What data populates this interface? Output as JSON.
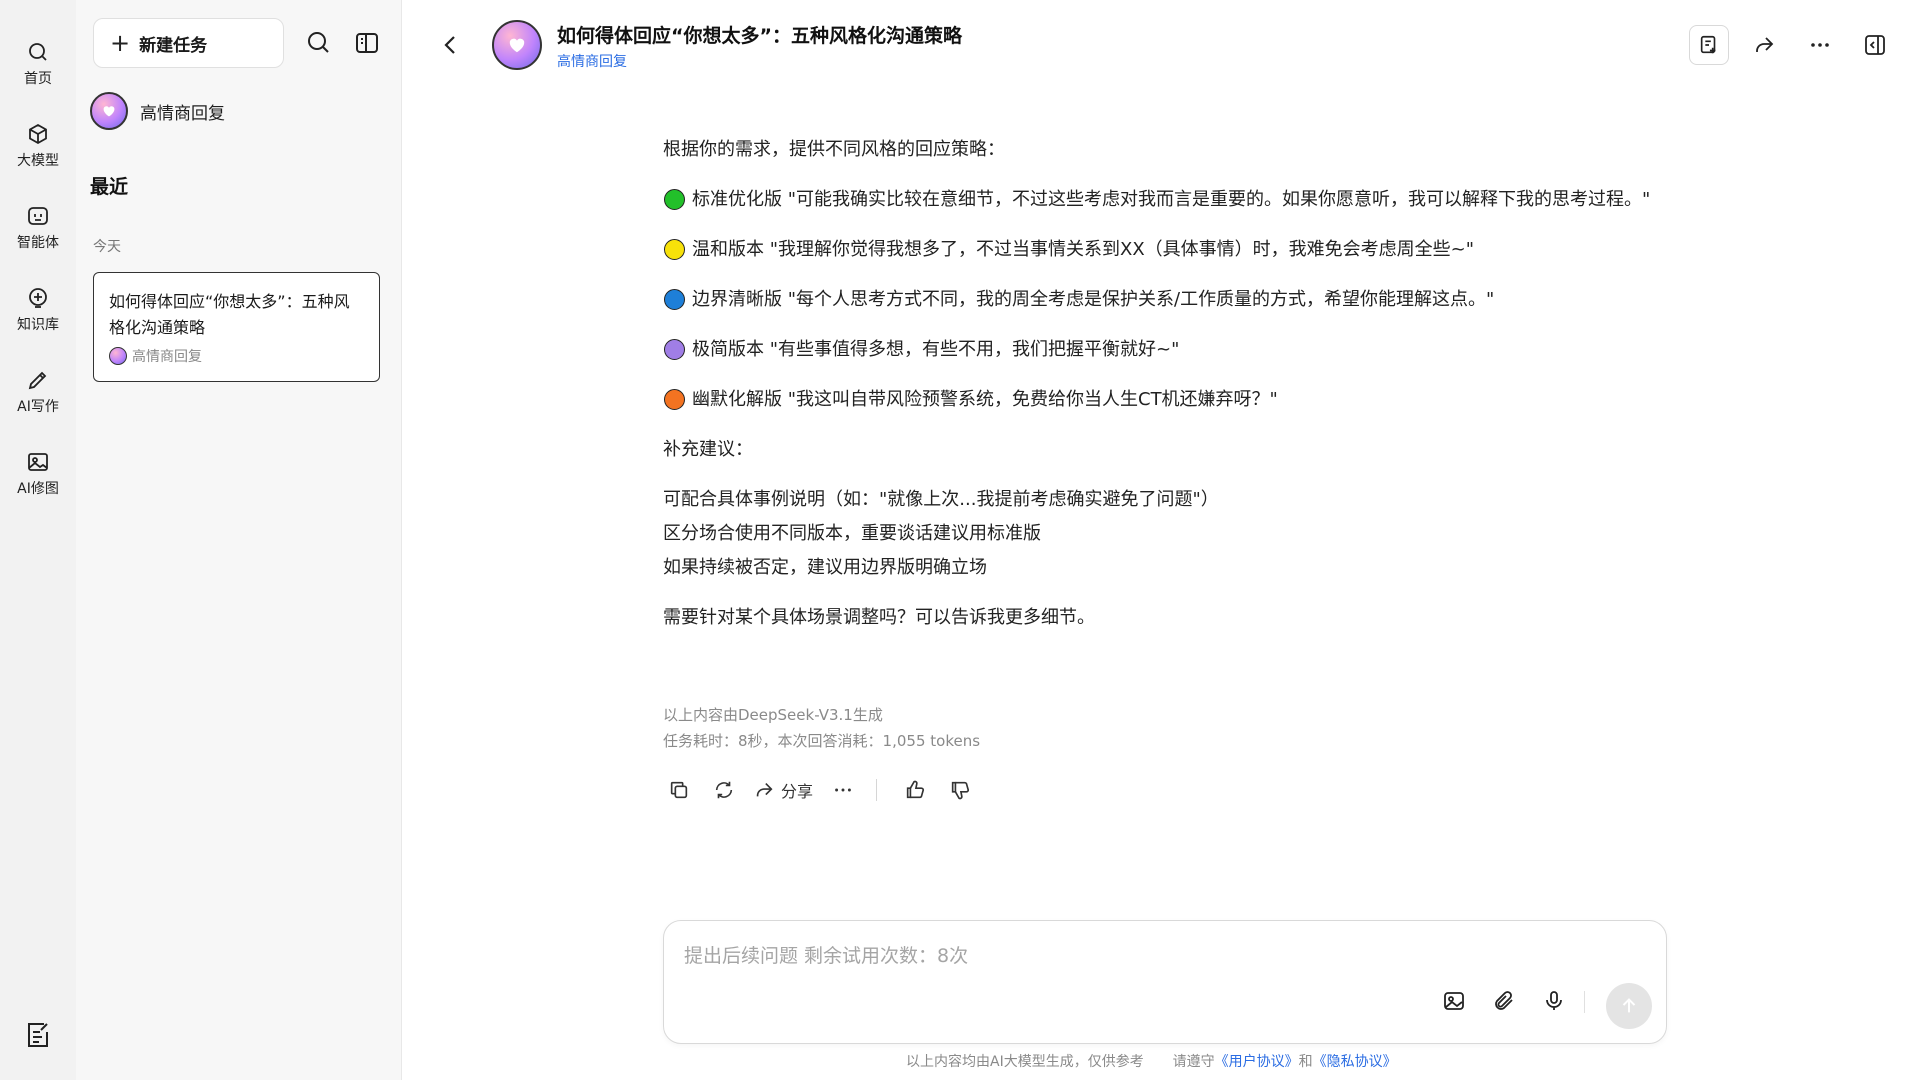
{
  "rail": {
    "items": [
      {
        "label": "首页",
        "icon": "search-icon"
      },
      {
        "label": "大模型",
        "icon": "cube-icon"
      },
      {
        "label": "智能体",
        "icon": "bot-icon"
      },
      {
        "label": "知识库",
        "icon": "knowledge-icon"
      },
      {
        "label": "AI写作",
        "icon": "pencil-icon"
      },
      {
        "label": "AI修图",
        "icon": "image-icon"
      }
    ]
  },
  "sidebar": {
    "new_task": "新建任务",
    "agent_name": "高情商回复",
    "recent_label": "最近",
    "today_label": "今天",
    "task": {
      "title": "如何得体回应“你想太多”：五种风格化沟通策略",
      "agent": "高情商回复"
    }
  },
  "header": {
    "title": "如何得体回应“你想太多”：五种风格化沟通策略",
    "subtitle": "高情商回复"
  },
  "message": {
    "intro": "根据你的需求，提供不同风格的回应策略：",
    "items": [
      {
        "color": "#22c02a",
        "text": "标准优化版 \"可能我确实比较在意细节，不过这些考虑对我而言是重要的。如果你愿意听，我可以解释下我的思考过程。\""
      },
      {
        "color": "#f7e10a",
        "text": "温和版本 \"我理解你觉得我想多了，不过当事情关系到XX（具体事情）时，我难免会考虑周全些~\""
      },
      {
        "color": "#1e7fd8",
        "text": "边界清晰版 \"每个人思考方式不同，我的周全考虑是保护关系/工作质量的方式，希望你能理解这点。\""
      },
      {
        "color": "#a07ee6",
        "text": "极简版本 \"有些事值得多想，有些不用，我们把握平衡就好~\""
      },
      {
        "color": "#f37321",
        "text": "幽默化解版 \"我这叫自带风险预警系统，免费给你当人生CT机还嫌弃呀？\""
      }
    ],
    "supplement_title": "补充建议：",
    "supplements": [
      "可配合具体事例说明（如：\"就像上次...我提前考虑确实避免了问题\"）",
      "区分场合使用不同版本，重要谈话建议用标准版",
      "如果持续被否定，建议用边界版明确立场"
    ],
    "closing": "需要针对某个具体场景调整吗？可以告诉我更多细节。",
    "meta_model": "以上内容由DeepSeek-V3.1生成",
    "meta_usage": "任务耗时：8秒，本次回答消耗：1,055 tokens",
    "share_label": "分享"
  },
  "input": {
    "placeholder": "提出后续问题 剩余试用次数：8次"
  },
  "footer": {
    "notice": "以上内容均由AI大模型生成，仅供参考",
    "comply": "请遵守",
    "user_agreement": "《用户协议》",
    "and": "和",
    "privacy": "《隐私协议》"
  }
}
